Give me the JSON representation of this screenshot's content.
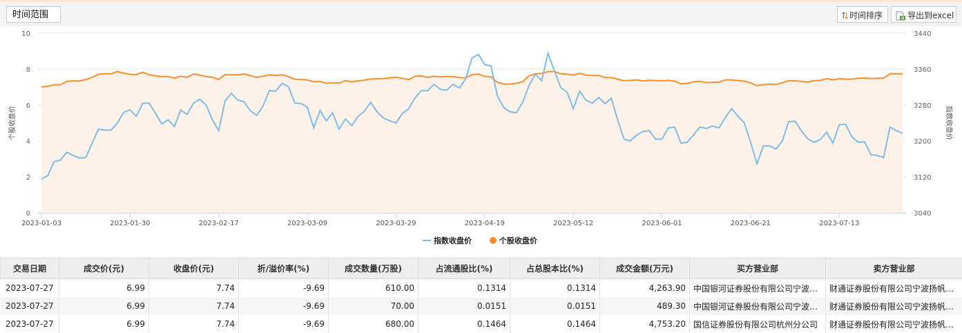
{
  "toolbar": {
    "time_range_label": "时间范围",
    "sort_label": "时间排序",
    "export_label": "导出到excel"
  },
  "colors": {
    "index_line": "#7cbde8",
    "stock_line": "#f98e2b",
    "area_fill": "#fdf1e8"
  },
  "chart_data": {
    "type": "line",
    "left_axis": {
      "label": "个股收盘价",
      "ticks": [
        "0",
        "2",
        "4",
        "6",
        "8",
        "10"
      ],
      "range": [
        0,
        10
      ]
    },
    "right_axis": {
      "label": "指数收盘价",
      "ticks": [
        "3040",
        "3120",
        "3200",
        "3280",
        "3360",
        "3440"
      ],
      "range": [
        3040,
        3440
      ]
    },
    "x_ticks": [
      {
        "index": 0,
        "label": "2023-01-03"
      },
      {
        "index": 14,
        "label": "2023-01-30"
      },
      {
        "index": 28,
        "label": "2023-02-17"
      },
      {
        "index": 42,
        "label": "2023-03-09"
      },
      {
        "index": 56,
        "label": "2023-03-29"
      },
      {
        "index": 70,
        "label": "2023-04-19"
      },
      {
        "index": 84,
        "label": "2023-05-12"
      },
      {
        "index": 98,
        "label": "2023-06-01"
      },
      {
        "index": 112,
        "label": "2023-06-21"
      },
      {
        "index": 126,
        "label": "2023-07-13"
      }
    ],
    "grid": true,
    "legend_position": "bottom",
    "series": [
      {
        "name": "指数收盘价",
        "axis": "right",
        "values": [
          3115,
          3123,
          3154,
          3157,
          3175,
          3168,
          3162,
          3163,
          3195,
          3226,
          3224,
          3224,
          3240,
          3264,
          3269,
          3255,
          3284,
          3284,
          3262,
          3238,
          3247,
          3232,
          3269,
          3259,
          3284,
          3293,
          3280,
          3247,
          3223,
          3289,
          3306,
          3291,
          3287,
          3267,
          3257,
          3278,
          3312,
          3311,
          3328,
          3321,
          3285,
          3283,
          3275,
          3229,
          3268,
          3245,
          3263,
          3226,
          3249,
          3234,
          3255,
          3266,
          3286,
          3265,
          3251,
          3245,
          3240,
          3261,
          3272,
          3296,
          3312,
          3312,
          3326,
          3315,
          3313,
          3326,
          3318,
          3338,
          3385,
          3393,
          3370,
          3367,
          3300,
          3275,
          3265,
          3263,
          3286,
          3323,
          3349,
          3334,
          3395,
          3357,
          3319,
          3309,
          3272,
          3311,
          3291,
          3284,
          3297,
          3283,
          3295,
          3247,
          3204,
          3200,
          3213,
          3221,
          3223,
          3204,
          3204,
          3229,
          3231,
          3195,
          3197,
          3214,
          3231,
          3228,
          3233,
          3229,
          3252,
          3272,
          3255,
          3240,
          3197,
          3149,
          3189,
          3189,
          3182,
          3200,
          3243,
          3244,
          3223,
          3205,
          3197,
          3203,
          3220,
          3195,
          3236,
          3237,
          3209,
          3197,
          3198,
          3169,
          3168,
          3163,
          3231,
          3223,
          3217
        ]
      },
      {
        "name": "个股收盘价",
        "axis": "left",
        "values": [
          7.01,
          7.04,
          7.13,
          7.13,
          7.31,
          7.35,
          7.33,
          7.42,
          7.53,
          7.71,
          7.74,
          7.74,
          7.86,
          7.77,
          7.71,
          7.69,
          7.83,
          7.68,
          7.63,
          7.58,
          7.58,
          7.5,
          7.6,
          7.54,
          7.73,
          7.67,
          7.59,
          7.55,
          7.42,
          7.69,
          7.69,
          7.68,
          7.73,
          7.64,
          7.54,
          7.6,
          7.68,
          7.65,
          7.68,
          7.58,
          7.44,
          7.42,
          7.4,
          7.3,
          7.32,
          7.21,
          7.23,
          7.22,
          7.36,
          7.29,
          7.35,
          7.38,
          7.45,
          7.46,
          7.47,
          7.51,
          7.55,
          7.49,
          7.41,
          7.6,
          7.62,
          7.54,
          7.6,
          7.56,
          7.59,
          7.58,
          7.53,
          7.51,
          7.69,
          7.72,
          7.6,
          7.56,
          7.27,
          7.17,
          7.17,
          7.21,
          7.3,
          7.62,
          7.74,
          7.76,
          7.86,
          7.87,
          7.74,
          7.72,
          7.67,
          7.76,
          7.67,
          7.64,
          7.65,
          7.53,
          7.53,
          7.44,
          7.35,
          7.37,
          7.4,
          7.33,
          7.38,
          7.36,
          7.35,
          7.37,
          7.33,
          7.18,
          7.21,
          7.29,
          7.32,
          7.24,
          7.27,
          7.28,
          7.4,
          7.4,
          7.36,
          7.33,
          7.23,
          7.08,
          7.13,
          7.17,
          7.14,
          7.24,
          7.35,
          7.35,
          7.31,
          7.28,
          7.35,
          7.37,
          7.47,
          7.4,
          7.47,
          7.44,
          7.44,
          7.49,
          7.51,
          7.47,
          7.49,
          7.5,
          7.74,
          7.74,
          7.73
        ]
      }
    ]
  },
  "table": {
    "headers": [
      "交易日期",
      "成交价(元)",
      "收盘价(元)",
      "折/溢价率(%)",
      "成交数量(万股)",
      "占流通股比(%)",
      "占总股本比(%)",
      "成交金额(万元)",
      "买方营业部",
      "卖方营业部"
    ],
    "rows": [
      [
        "2023-07-27",
        "6.99",
        "7.74",
        "-9.69",
        "610.00",
        "0.1314",
        "0.1314",
        "4,263.90",
        "中国银河证券股份有限公司宁波…",
        "财通证券股份有限公司宁波扬帆…"
      ],
      [
        "2023-07-27",
        "6.99",
        "7.74",
        "-9.69",
        "70.00",
        "0.0151",
        "0.0151",
        "489.30",
        "中国银河证券股份有限公司宁波…",
        "财通证券股份有限公司宁波扬帆…"
      ],
      [
        "2023-07-27",
        "6.99",
        "7.74",
        "-9.69",
        "680.00",
        "0.1464",
        "0.1464",
        "4,753.20",
        "国信证券股份有限公司杭州分公司",
        "财通证券股份有限公司宁波扬帆…"
      ]
    ]
  }
}
